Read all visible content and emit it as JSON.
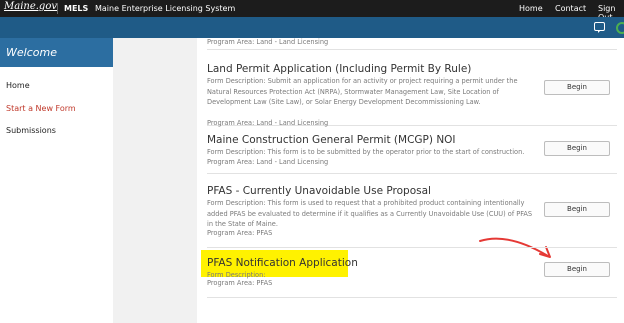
{
  "topbar": {
    "brand": "Maine.gov",
    "app_short": "MELS",
    "app_name": "Maine Enterprise Licensing System",
    "nav": [
      "Home",
      "Contact",
      "Sign Out"
    ]
  },
  "header_icons": {
    "messages": "message-icon",
    "status": "status-circle-icon"
  },
  "sidebar": {
    "heading": "Welcome",
    "items": [
      {
        "label": "Home",
        "active": false
      },
      {
        "label": "Start a New Form",
        "active": true
      },
      {
        "label": "Submissions",
        "active": false
      }
    ]
  },
  "forms": {
    "prev_area": "Program Area: Land - Land Licensing",
    "items": [
      {
        "title": "Land Permit Application (Including Permit By Rule)",
        "desc": "Form Description: Submit an application for an activity or project requiring a permit under the Natural Resources Protection Act (NRPA), Stormwater Management Law, Site Location of Development Law (Site Law), or Solar Energy Development Decommissioning Law.",
        "area": "Program Area: Land - Land Licensing",
        "button": "Begin"
      },
      {
        "title": "Maine Construction General Permit (MCGP) NOI",
        "desc": "Form Description: This form is to be submitted by the operator prior to the start of construction.",
        "area": "Program Area: Land - Land Licensing",
        "button": "Begin"
      },
      {
        "title": "PFAS - Currently Unavoidable Use Proposal",
        "desc": "Form Description: This form is used to request that a prohibited product containing intentionally added PFAS be evaluated to determine if it qualifies as a Currently Unavoidable Use (CUU) of PFAS in the State of Maine.",
        "area": "Program Area: PFAS",
        "button": "Begin"
      },
      {
        "title": "PFAS Notification Application",
        "desc": "Form Description:",
        "area": "Program Area: PFAS",
        "button": "Begin"
      }
    ]
  },
  "annotation_colors": {
    "highlight": "#fff200",
    "arrow": "#e53935"
  }
}
